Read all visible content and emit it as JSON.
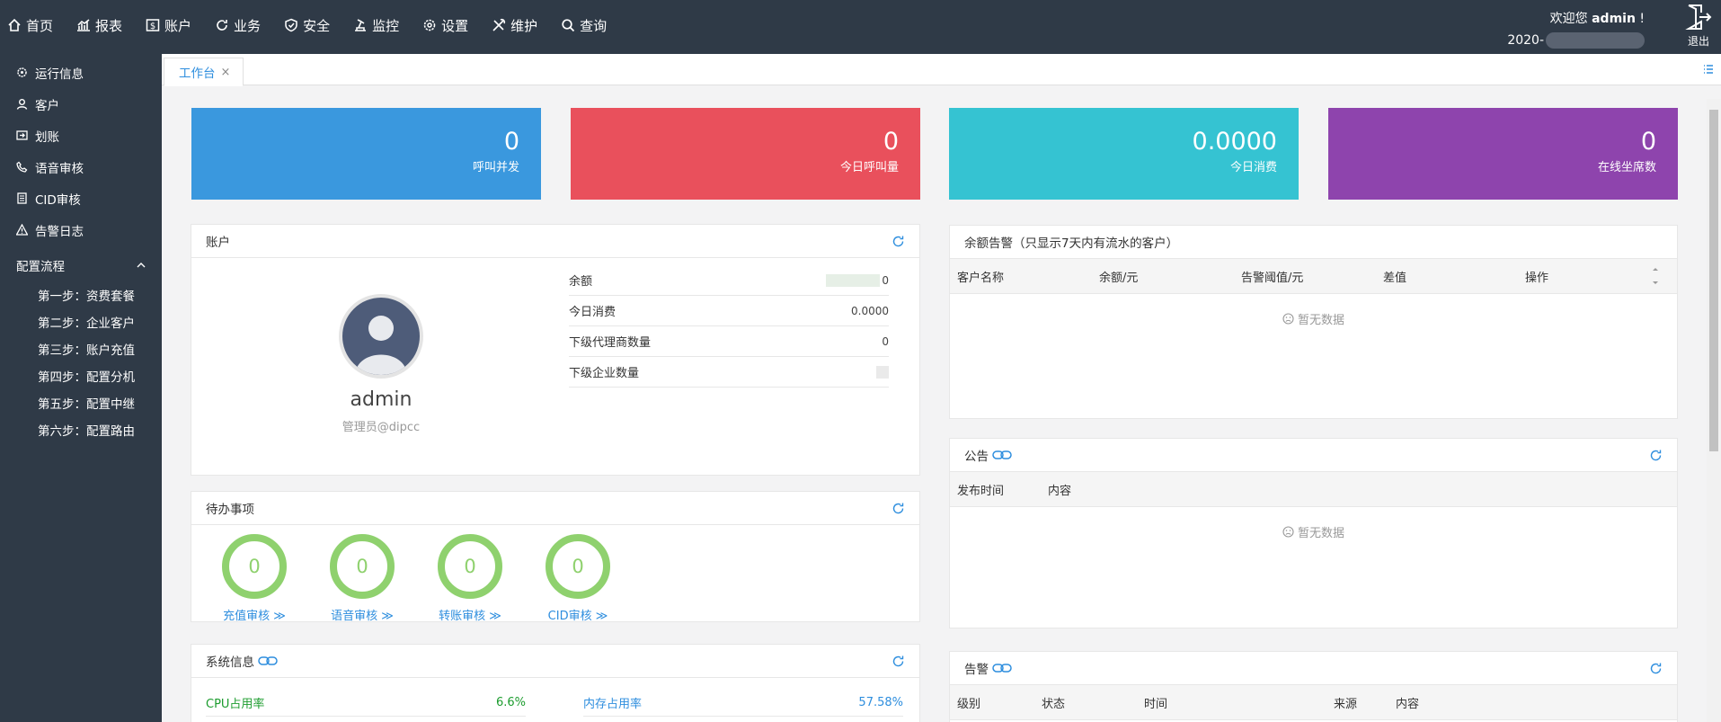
{
  "topnav": [
    {
      "label": "首页",
      "icon": "home-icon"
    },
    {
      "label": "报表",
      "icon": "chart-icon"
    },
    {
      "label": "账户",
      "icon": "dollar-icon"
    },
    {
      "label": "业务",
      "icon": "refresh-cycle-icon"
    },
    {
      "label": "安全",
      "icon": "shield-icon"
    },
    {
      "label": "监控",
      "icon": "monitor-icon"
    },
    {
      "label": "设置",
      "icon": "gear-icon"
    },
    {
      "label": "维护",
      "icon": "wrench-icon"
    },
    {
      "label": "查询",
      "icon": "search-icon"
    }
  ],
  "user": {
    "welcome_prefix": "欢迎您",
    "name": "admin",
    "welcome_suffix": "!",
    "date_prefix": "2020-",
    "logout_label": "退出"
  },
  "sidebar": {
    "items": [
      {
        "label": "运行信息",
        "icon": "gear-icon"
      },
      {
        "label": "客户",
        "icon": "user-icon"
      },
      {
        "label": "划账",
        "icon": "transfer-icon"
      },
      {
        "label": "语音审核",
        "icon": "phone-icon"
      },
      {
        "label": "CID审核",
        "icon": "document-icon"
      },
      {
        "label": "告警日志",
        "icon": "warning-icon"
      }
    ],
    "group_label": "配置流程",
    "sub_items": [
      "第一步：资费套餐",
      "第二步：企业客户",
      "第三步：账户充值",
      "第四步：配置分机",
      "第五步：配置中继",
      "第六步：配置路由"
    ]
  },
  "tab": {
    "label": "工作台",
    "close": "×"
  },
  "stats": [
    {
      "value": "0",
      "label": "呼叫并发",
      "color": "#3a98de"
    },
    {
      "value": "0",
      "label": "今日呼叫量",
      "color": "#e9505c"
    },
    {
      "value": "0.0000",
      "label": "今日消费",
      "color": "#35c3d2"
    },
    {
      "value": "0",
      "label": "在线坐席数",
      "color": "#8e44ad"
    }
  ],
  "account": {
    "title": "账户",
    "name": "admin",
    "role": "管理员@dipcc",
    "rows": [
      {
        "label": "余额",
        "value": "0"
      },
      {
        "label": "今日消费",
        "value": "0.0000"
      },
      {
        "label": "下级代理商数量",
        "value": "0"
      },
      {
        "label": "下级企业数量",
        "value": ""
      }
    ]
  },
  "todo": {
    "title": "待办事项",
    "items": [
      {
        "value": "0",
        "label": "充值审核 ≫"
      },
      {
        "value": "0",
        "label": "语音审核 ≫"
      },
      {
        "value": "0",
        "label": "转账审核 ≫"
      },
      {
        "value": "0",
        "label": "CID审核 ≫"
      }
    ]
  },
  "system": {
    "title": "系统信息",
    "cpu_label": "CPU占用率",
    "cpu_value": "6.6%",
    "mem_label": "内存占用率",
    "mem_value": "57.58%",
    "cpu_color": "#1c9c2e",
    "mem_color": "#2e8ede"
  },
  "balance_alert": {
    "title": "余额告警（只显示7天内有流水的客户）",
    "columns": [
      "客户名称",
      "余额/元",
      "告警阈值/元",
      "差值",
      "操作"
    ],
    "empty": "暂无数据"
  },
  "notice": {
    "title": "公告",
    "columns": [
      "发布时间",
      "内容"
    ],
    "empty": "暂无数据"
  },
  "alarm": {
    "title": "告警",
    "columns": [
      "级别",
      "状态",
      "时间",
      "来源",
      "内容"
    ]
  }
}
